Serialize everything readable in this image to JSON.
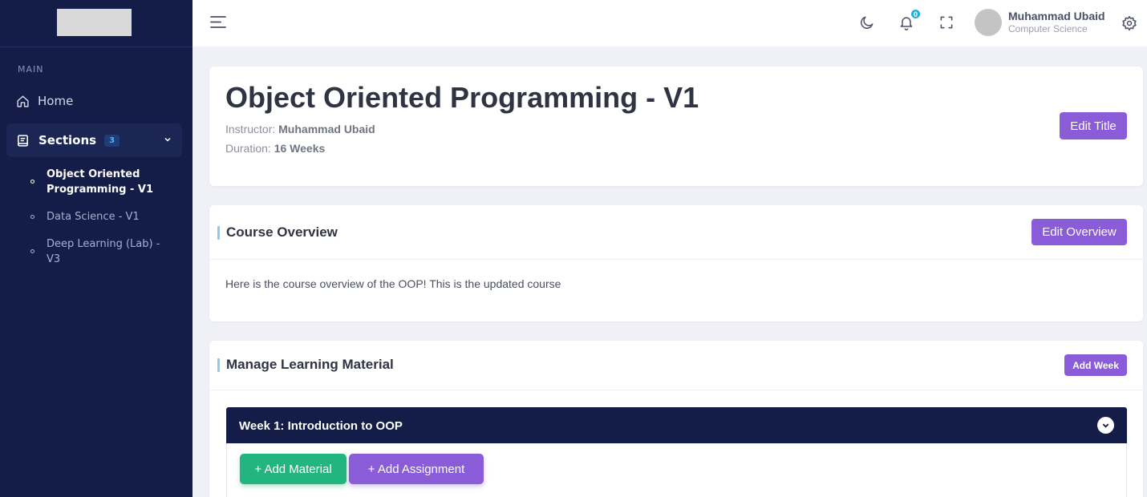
{
  "sidebar": {
    "heading": "MAIN",
    "home_label": "Home",
    "sections_label": "Sections",
    "sections_count": "3",
    "items": [
      {
        "label": "Object Oriented Programming - V1",
        "active": true
      },
      {
        "label": "Data Science - V1",
        "active": false
      },
      {
        "label": "Deep Learning (Lab) - V3",
        "active": false
      }
    ]
  },
  "header": {
    "notification_count": "0",
    "user_name": "Muhammad Ubaid",
    "user_role": "Computer Science"
  },
  "course": {
    "title": "Object Oriented Programming - V1",
    "instructor_label": "Instructor:",
    "instructor": "Muhammad Ubaid",
    "duration_label": "Duration:",
    "duration": "16 Weeks",
    "edit_title_label": "Edit Title"
  },
  "overview": {
    "heading": "Course Overview",
    "edit_label": "Edit Overview",
    "text": "Here is the course overview of the OOP! This is the updated course"
  },
  "material": {
    "heading": "Manage Learning Material",
    "add_week_label": "Add Week",
    "weeks": [
      {
        "title": "Week 1: Introduction to OOP",
        "add_material_label": "+ Add Material",
        "add_assignment_label": "+ Add Assignment"
      }
    ]
  },
  "colors": {
    "sidebar_bg": "#141d47",
    "accent_purple": "#8a5cd8",
    "accent_green": "#22b57f",
    "badge_blue": "#1fb0d8"
  }
}
